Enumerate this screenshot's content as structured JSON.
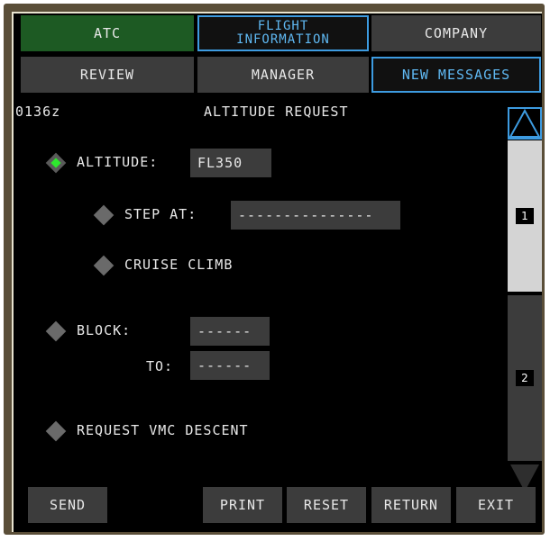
{
  "tabs": {
    "atc": "ATC",
    "flight_info": "FLIGHT\nINFORMATION",
    "company": "COMPANY",
    "review": "REVIEW",
    "manager": "MANAGER",
    "new_messages": "NEW MESSAGES"
  },
  "header": {
    "time": "0136z",
    "title": "ALTITUDE REQUEST"
  },
  "form": {
    "altitude_label": "ALTITUDE:",
    "altitude_value": "FL350",
    "step_at_label": "STEP AT:",
    "step_at_value": "---------------",
    "cruise_climb_label": "CRUISE CLIMB",
    "block_label": "BLOCK:",
    "block_value": "------",
    "to_label": "TO:",
    "to_value": "------",
    "vmc_label": "REQUEST VMC DESCENT"
  },
  "pager": {
    "page1": "1",
    "page2": "2",
    "up_icon": "triangle-up-icon",
    "down_icon": "triangle-down-icon"
  },
  "footer": {
    "send": "SEND",
    "print": "PRINT",
    "reset": "RESET",
    "return": "RETURN",
    "exit": "EXIT"
  },
  "colors": {
    "active_tab": "#1d5a23",
    "outline": "#3d9be0",
    "selected_diamond": "#2ee82e",
    "button": "#3c3c3c"
  }
}
